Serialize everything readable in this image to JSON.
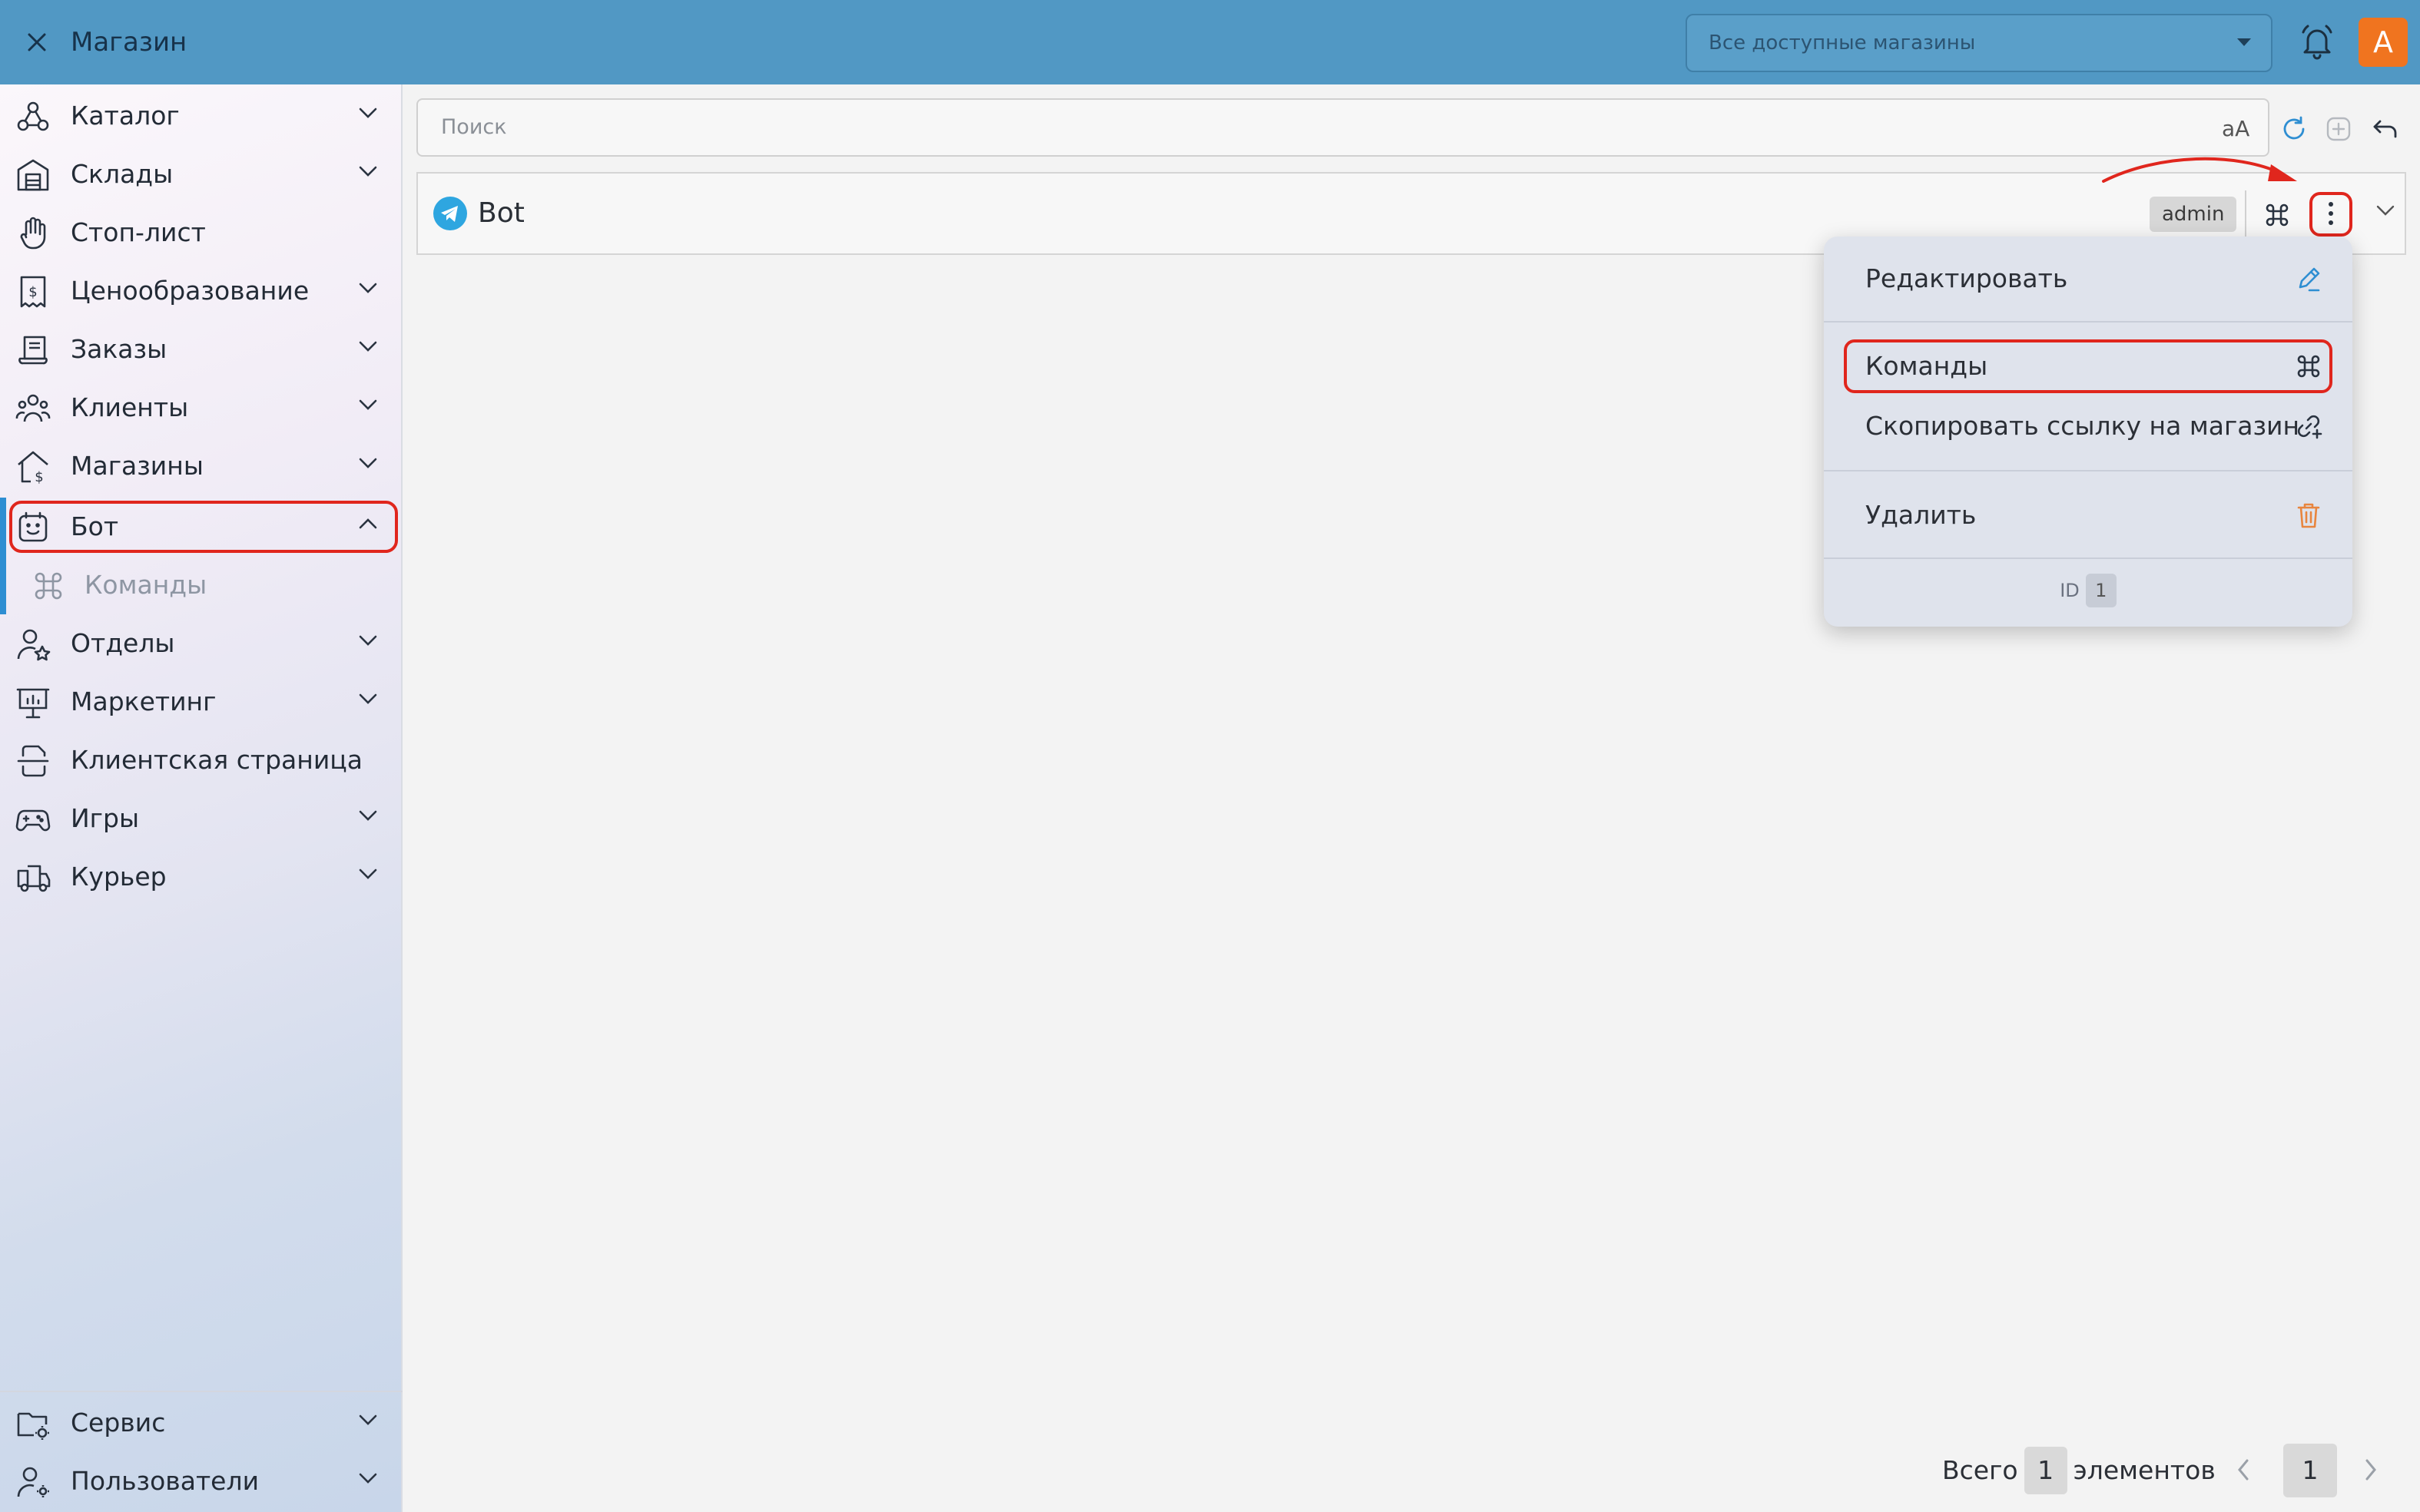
{
  "header": {
    "title": "Магазин",
    "store_select": "Все доступные магазины",
    "avatar_letter": "A",
    "accent": "#5198c4"
  },
  "sidebar": {
    "items": [
      {
        "label": "Каталог",
        "icon": "catalog-icon",
        "has_chevron": true
      },
      {
        "label": "Склады",
        "icon": "warehouse-icon",
        "has_chevron": true
      },
      {
        "label": "Стоп-лист",
        "icon": "hand-stop-icon",
        "has_chevron": false
      },
      {
        "label": "Ценообразование",
        "icon": "price-receipt-icon",
        "has_chevron": true
      },
      {
        "label": "Заказы",
        "icon": "orders-icon",
        "has_chevron": true
      },
      {
        "label": "Клиенты",
        "icon": "clients-icon",
        "has_chevron": true
      },
      {
        "label": "Магазины",
        "icon": "store-house-icon",
        "has_chevron": true
      },
      {
        "label": "Бот",
        "icon": "bot-icon",
        "has_chevron": true,
        "expanded": true
      },
      {
        "label": "Команды",
        "icon": "command-icon",
        "sub": true
      },
      {
        "label": "Отделы",
        "icon": "department-icon",
        "has_chevron": true
      },
      {
        "label": "Маркетинг",
        "icon": "presentation-icon",
        "has_chevron": true
      },
      {
        "label": "Клиентская страница",
        "icon": "page-scan-icon",
        "has_chevron": false
      },
      {
        "label": "Игры",
        "icon": "gamepad-icon",
        "has_chevron": true
      },
      {
        "label": "Курьер",
        "icon": "truck-icon",
        "has_chevron": true
      }
    ],
    "bottom_items": [
      {
        "label": "Сервис",
        "icon": "folder-gear-icon"
      },
      {
        "label": "Пользователи",
        "icon": "users-gear-icon"
      }
    ]
  },
  "search": {
    "placeholder": "Поиск",
    "case_toggle": "aA"
  },
  "row": {
    "title": "Bot",
    "badge": "admin"
  },
  "menu": {
    "edit": "Редактировать",
    "commands": "Команды",
    "copy_link": "Скопировать ссылку на магазин",
    "delete": "Удалить",
    "id_label": "ID",
    "id_value": "1"
  },
  "footer": {
    "total_prefix": "Всего",
    "total_count": "1",
    "total_suffix": "элементов",
    "current_page": "1"
  }
}
